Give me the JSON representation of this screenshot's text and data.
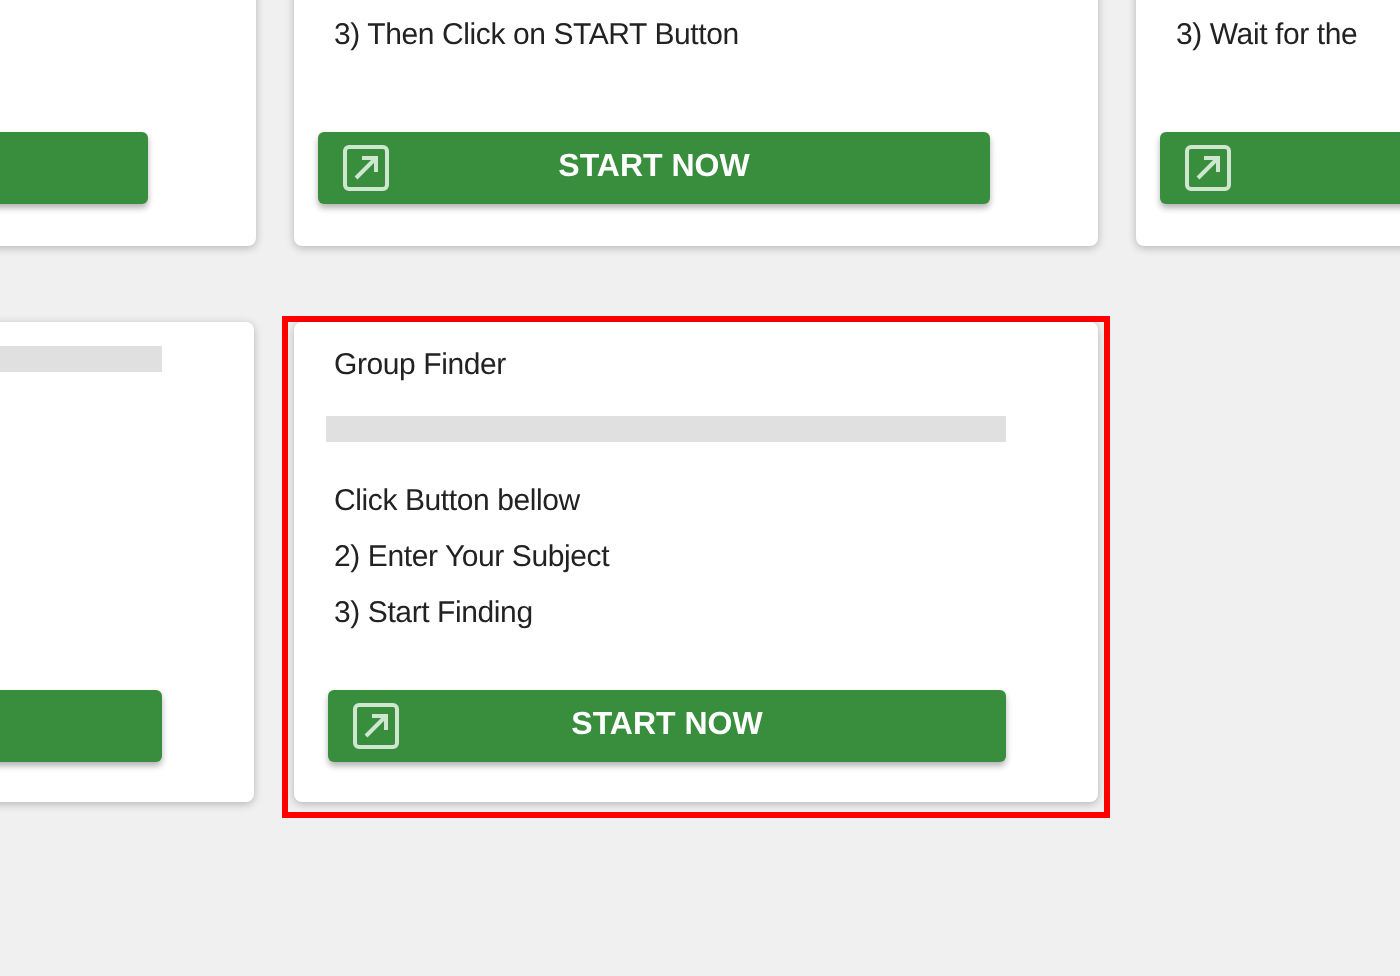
{
  "rows": [
    {
      "cards": [
        {
          "highlighted": false,
          "button": {
            "kind": "plain"
          }
        },
        {
          "highlighted": false,
          "lines": [
            "3) Then Click on START Button"
          ],
          "button": {
            "kind": "icon",
            "label": "START NOW"
          }
        },
        {
          "highlighted": false,
          "lines": [
            "3) Wait for the"
          ],
          "button": {
            "kind": "icon"
          }
        }
      ]
    },
    {
      "cards": [
        {
          "highlighted": false,
          "divider": true,
          "button": {
            "kind": "plain"
          }
        },
        {
          "highlighted": true,
          "title": "Group Finder",
          "divider": true,
          "lines": [
            "Click Button bellow",
            "2) Enter Your Subject",
            "3) Start Finding"
          ],
          "button": {
            "kind": "icon",
            "label": "START NOW"
          }
        }
      ]
    }
  ]
}
